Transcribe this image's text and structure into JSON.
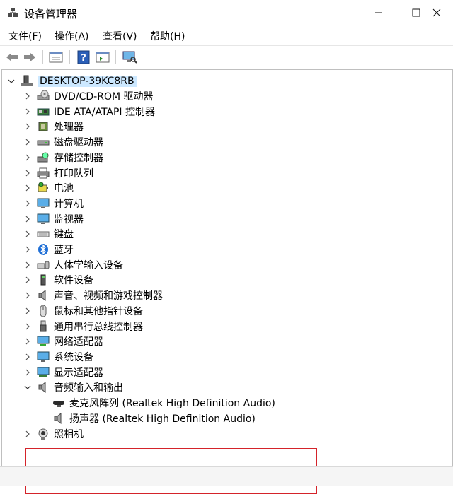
{
  "window": {
    "title": "设备管理器"
  },
  "menubar": {
    "items": [
      "文件(F)",
      "操作(A)",
      "查看(V)",
      "帮助(H)"
    ]
  },
  "tree": {
    "root": "DESKTOP-39KC8RB",
    "categories": [
      {
        "label": "DVD/CD-ROM 驱动器",
        "icon": "disc-drive-icon"
      },
      {
        "label": "IDE ATA/ATAPI 控制器",
        "icon": "ide-controller-icon"
      },
      {
        "label": "处理器",
        "icon": "processor-icon"
      },
      {
        "label": "磁盘驱动器",
        "icon": "disk-drive-icon"
      },
      {
        "label": "存储控制器",
        "icon": "storage-controller-icon"
      },
      {
        "label": "打印队列",
        "icon": "printer-icon"
      },
      {
        "label": "电池",
        "icon": "battery-icon"
      },
      {
        "label": "计算机",
        "icon": "computer-icon"
      },
      {
        "label": "监视器",
        "icon": "monitor-icon"
      },
      {
        "label": "键盘",
        "icon": "keyboard-icon"
      },
      {
        "label": "蓝牙",
        "icon": "bluetooth-icon"
      },
      {
        "label": "人体学输入设备",
        "icon": "hid-icon"
      },
      {
        "label": "软件设备",
        "icon": "software-device-icon"
      },
      {
        "label": "声音、视频和游戏控制器",
        "icon": "speaker-icon"
      },
      {
        "label": "鼠标和其他指针设备",
        "icon": "mouse-icon"
      },
      {
        "label": "通用串行总线控制器",
        "icon": "usb-icon"
      },
      {
        "label": "网络适配器",
        "icon": "network-adapter-icon"
      },
      {
        "label": "系统设备",
        "icon": "system-device-icon"
      },
      {
        "label": "显示适配器",
        "icon": "display-adapter-icon"
      }
    ],
    "audio_io": {
      "label": "音频输入和输出",
      "children": [
        {
          "label": "麦克风阵列 (Realtek High Definition Audio)",
          "icon": "microphone-icon"
        },
        {
          "label": "扬声器 (Realtek High Definition Audio)",
          "icon": "speaker-icon"
        }
      ]
    },
    "camera": {
      "label": "照相机",
      "icon": "camera-icon"
    }
  },
  "colors": {
    "selection": "#cce8ff",
    "highlight_box": "#d4232a"
  }
}
